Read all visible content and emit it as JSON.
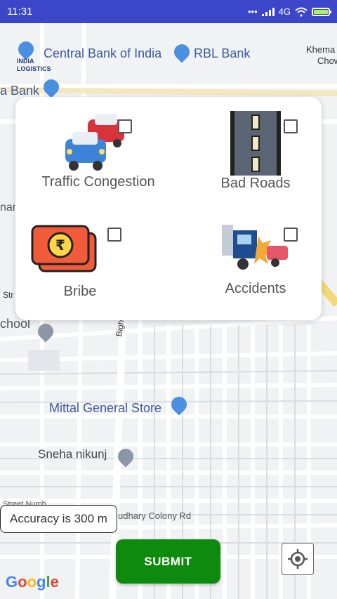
{
  "status_bar": {
    "time": "11:31",
    "network": "4G",
    "color": "#3b46c9"
  },
  "map": {
    "labels": {
      "central_bank": "Central Bank of India",
      "rbl_bank": "RBL Bank",
      "khema": "Khema",
      "chow": "Chow",
      "a_bank": "a Bank",
      "india_logistics_1": "INDIA",
      "india_logistics_2": "LOGISTICS",
      "nan": "nan",
      "str": "Str",
      "school": "chool",
      "bigha": "Bigha",
      "mittal": "Mittal General Store",
      "sneha": "Sneha nikunj",
      "colony_rd": "udhary Colony Rd",
      "street_num": "Street Numb"
    }
  },
  "card": {
    "options": [
      {
        "label": "Traffic Congestion",
        "icon": "traffic-congestion-icon",
        "checked": false
      },
      {
        "label": "Bad Roads",
        "icon": "bad-roads-icon",
        "checked": false
      },
      {
        "label": "Bribe",
        "icon": "bribe-icon",
        "checked": false
      },
      {
        "label": "Accidents",
        "icon": "accident-icon",
        "checked": false
      }
    ]
  },
  "accuracy": {
    "text": "Accuracy is 300 m"
  },
  "submit": {
    "label": "SUBMIT",
    "color": "#0e8a0e"
  },
  "google": {
    "letters": [
      "G",
      "o",
      "o",
      "g",
      "l",
      "e"
    ]
  }
}
